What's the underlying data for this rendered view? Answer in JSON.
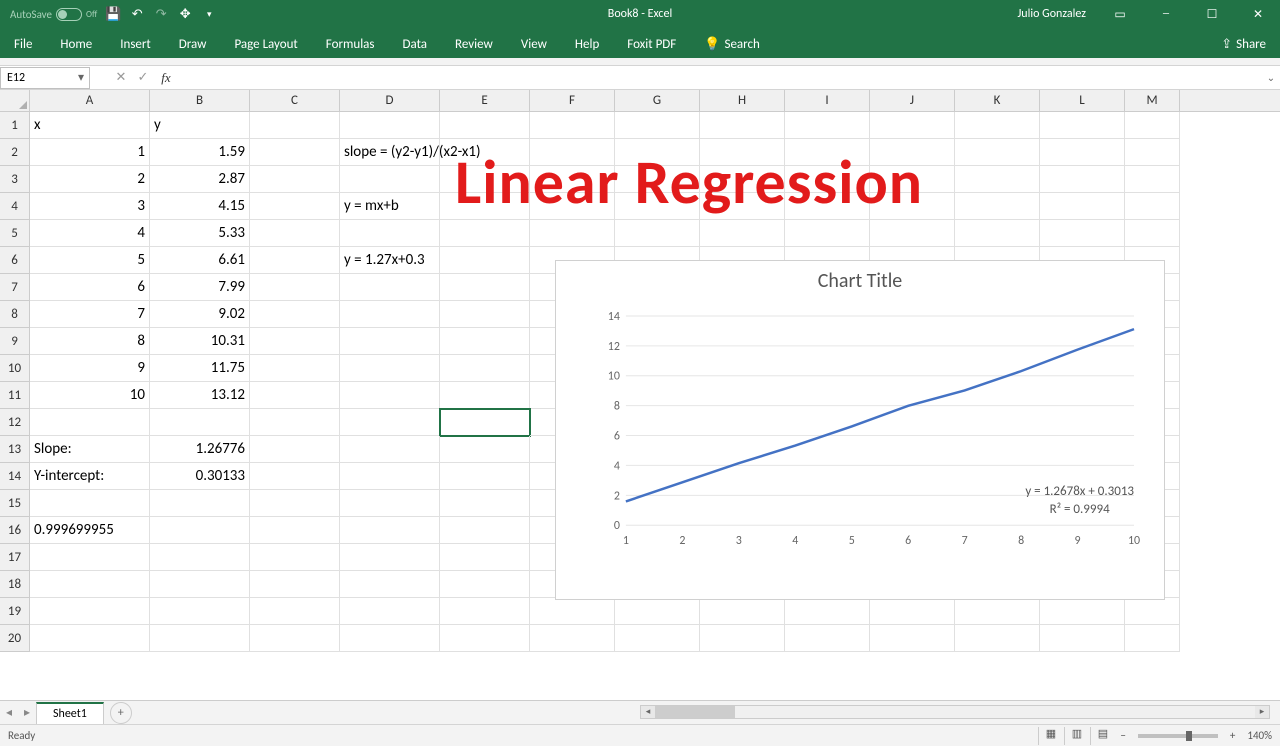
{
  "titlebar": {
    "autosave": "AutoSave",
    "autosave_state": "Off",
    "doc": "Book8  -  Excel",
    "user": "Julio Gonzalez"
  },
  "ribbon": {
    "tabs": [
      "File",
      "Home",
      "Insert",
      "Draw",
      "Page Layout",
      "Formulas",
      "Data",
      "Review",
      "View",
      "Help",
      "Foxit PDF"
    ],
    "search": "Search",
    "share": "Share"
  },
  "fbar": {
    "namebox": "E12",
    "formula": ""
  },
  "columns": [
    "A",
    "B",
    "C",
    "D",
    "E",
    "F",
    "G",
    "H",
    "I",
    "J",
    "K",
    "L",
    "M"
  ],
  "cells": {
    "A1": "x",
    "B1": "y",
    "A2": "1",
    "B2": "1.59",
    "A3": "2",
    "B3": "2.87",
    "A4": "3",
    "B4": "4.15",
    "A5": "4",
    "B5": "5.33",
    "A6": "5",
    "B6": "6.61",
    "A7": "6",
    "B7": "7.99",
    "A8": "7",
    "B8": "9.02",
    "A9": "8",
    "B9": "10.31",
    "A10": "9",
    "B10": "11.75",
    "A11": "10",
    "B11": "13.12",
    "A13": "Slope:",
    "B13": "1.26776",
    "A14": "Y-intercept:",
    "B14": "0.30133",
    "A16": "0.999699955",
    "D2": "slope = (y2-y1)/(x2-x1)",
    "D4": "y = mx+b",
    "D6": "y = 1.27x+0.3"
  },
  "overlay": "Linear Regression",
  "chart_data": {
    "type": "line",
    "title": "Chart Title",
    "categories": [
      1,
      2,
      3,
      4,
      5,
      6,
      7,
      8,
      9,
      10
    ],
    "values": [
      1.59,
      2.87,
      4.15,
      5.33,
      6.61,
      7.99,
      9.02,
      10.31,
      11.75,
      13.12
    ],
    "ylim": [
      0,
      14
    ],
    "y_ticks": [
      0,
      2,
      4,
      6,
      8,
      10,
      12,
      14
    ],
    "equation": "y = 1.2678x + 0.3013",
    "r2": "R² = 0.9994"
  },
  "sheet": {
    "active": "Sheet1"
  },
  "status": {
    "ready": "Ready",
    "zoom": "140%"
  }
}
